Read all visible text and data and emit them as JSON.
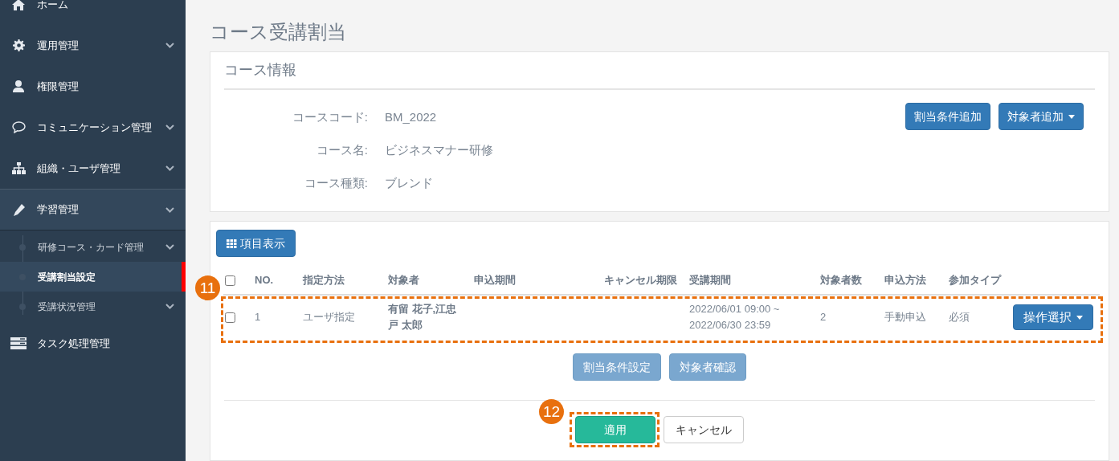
{
  "sidebar": {
    "items": [
      {
        "label": "ホーム",
        "expandable": false
      },
      {
        "label": "運用管理",
        "expandable": true
      },
      {
        "label": "権限管理",
        "expandable": false
      },
      {
        "label": "コミュニケーション管理",
        "expandable": true
      },
      {
        "label": "組織・ユーザ管理",
        "expandable": true
      },
      {
        "label": "学習管理",
        "expandable": true,
        "expanded": true,
        "children": [
          {
            "label": "研修コース・カード管理",
            "expandable": true,
            "selected": false
          },
          {
            "label": "受講割当設定",
            "expandable": false,
            "selected": true
          },
          {
            "label": "受講状況管理",
            "expandable": true,
            "selected": false
          }
        ]
      },
      {
        "label": "タスク処理管理",
        "expandable": false
      }
    ]
  },
  "page_title": "コース受講割当",
  "course_info": {
    "title": "コース情報",
    "fields": [
      {
        "label": "コースコード:",
        "value": "BM_2022"
      },
      {
        "label": "コース名:",
        "value": "ビジネスマナー研修"
      },
      {
        "label": "コース種類:",
        "value": "ブレンド"
      }
    ],
    "buttons": [
      {
        "label": "割当条件追加",
        "dropdown": false
      },
      {
        "label": "対象者追加",
        "dropdown": true
      }
    ]
  },
  "assignments": {
    "columns_button": "項目表示",
    "header_checked": false,
    "columns": [
      "NO.",
      "指定方法",
      "対象者",
      "申込期間",
      "キャンセル期限",
      "受講期間",
      "対象者数",
      "申込方法",
      "参加タイプ"
    ],
    "rows": [
      {
        "checked": false,
        "cells": [
          "1",
          "ユーザ指定",
          "有留 花子,江忠戸 太郎",
          "",
          "",
          "2022/06/01 09:00 ~ 2022/06/30 23:59",
          "2",
          "手動申込",
          "必須"
        ],
        "action": "操作選択"
      }
    ],
    "buttons": [
      {
        "label": "割当条件設定",
        "disabled": true
      },
      {
        "label": "対象者確認",
        "disabled": true
      }
    ],
    "footer_buttons": [
      {
        "label": "適用",
        "kind": "primary"
      },
      {
        "label": "キャンセル",
        "kind": "default"
      }
    ]
  },
  "annotations": [
    {
      "label": "11"
    },
    {
      "label": "12"
    }
  ]
}
